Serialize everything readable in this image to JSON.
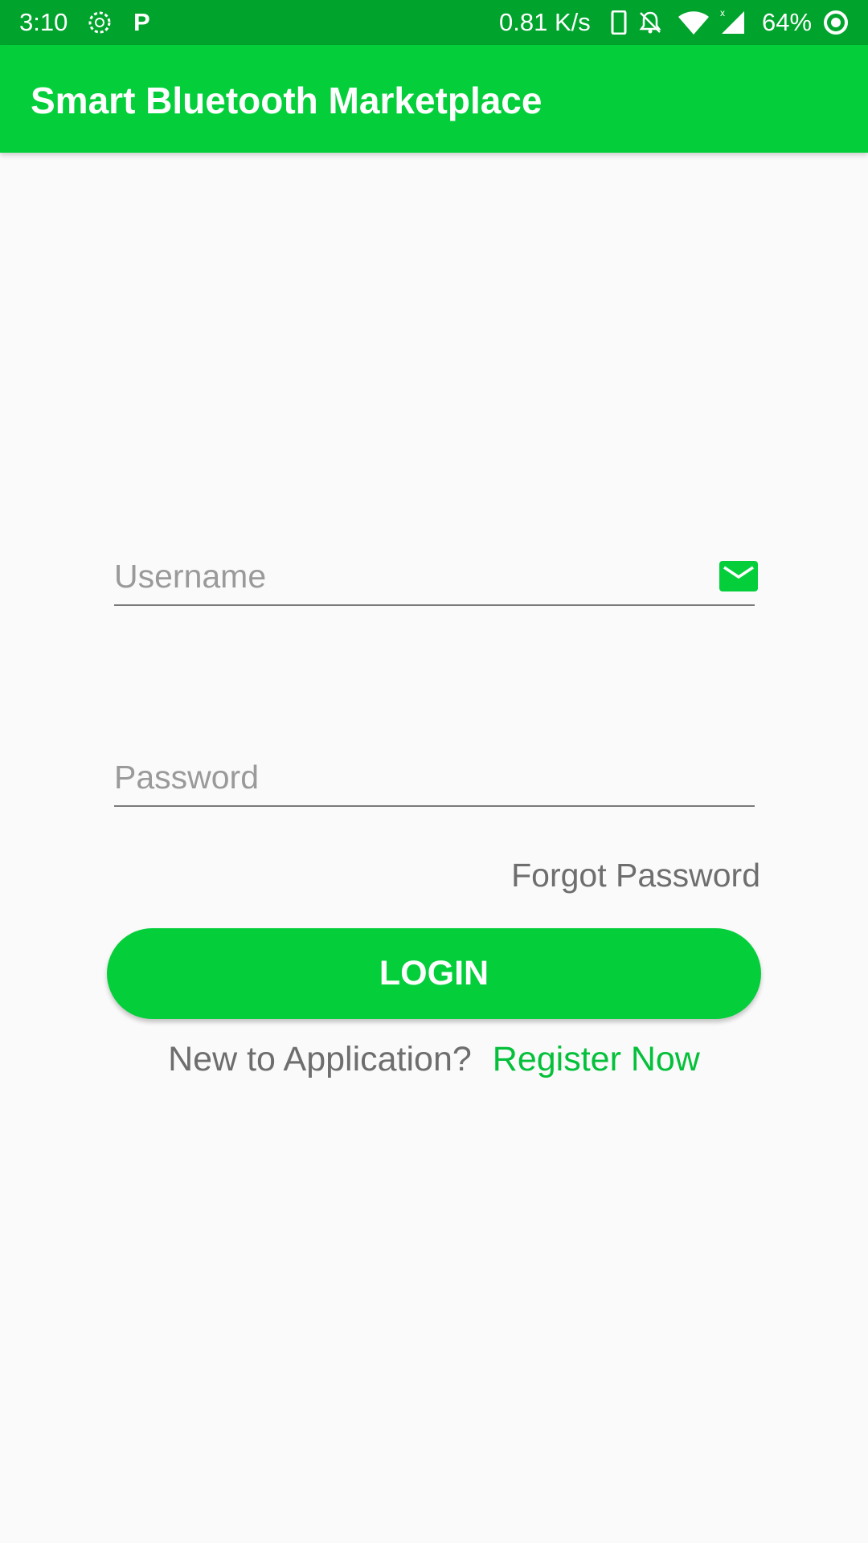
{
  "status_bar": {
    "time": "3:10",
    "p_label": "P",
    "network_speed": "0.81 K/s",
    "battery": "64%",
    "icons": [
      "sync-icon",
      "phone-icon",
      "bell-off-icon",
      "wifi-icon",
      "signal-icon",
      "battery-icon"
    ]
  },
  "app_bar": {
    "title": "Smart Bluetooth Marketplace",
    "color": "#04cf3b"
  },
  "form": {
    "username": {
      "placeholder": "Username",
      "value": "",
      "icon": "mail-icon"
    },
    "password": {
      "placeholder": "Password",
      "value": ""
    },
    "forgot_password": "Forgot Password",
    "login_label": "LOGIN",
    "register_prompt": "New to Application?",
    "register_link": "Register Now"
  },
  "colors": {
    "accent": "#04cf3b",
    "status_bar": "#00a42c",
    "link": "#04c03a"
  }
}
